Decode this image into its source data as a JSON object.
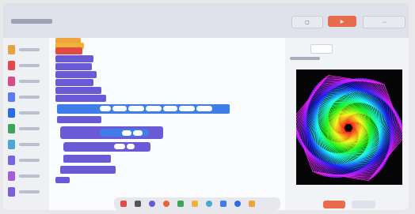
{
  "header": {
    "title_text": "",
    "buttons": [
      {
        "icon": "save-icon",
        "label": ""
      },
      {
        "icon": "play-icon",
        "label": ""
      },
      {
        "icon": "more-icon",
        "label": ""
      }
    ]
  },
  "palette": {
    "categories": [
      {
        "color": "#e6a23c"
      },
      {
        "color": "#e24a4a"
      },
      {
        "color": "#d94a8c"
      },
      {
        "color": "#5b7cf0"
      },
      {
        "color": "#2b6be6"
      },
      {
        "color": "#3fa45b"
      },
      {
        "color": "#4aa8d4"
      },
      {
        "color": "#7a63e0"
      },
      {
        "color": "#a45fd6"
      },
      {
        "color": "#7b5dd9"
      }
    ]
  },
  "right_panel": {
    "tabs": [
      "",
      ""
    ],
    "output_label": ""
  },
  "colors": {
    "run": "#e86b4c",
    "block_purple": "#6b59d6",
    "block_blue": "#3f7de8",
    "block_orange": "#f1a33b",
    "block_red": "#e2493f"
  }
}
